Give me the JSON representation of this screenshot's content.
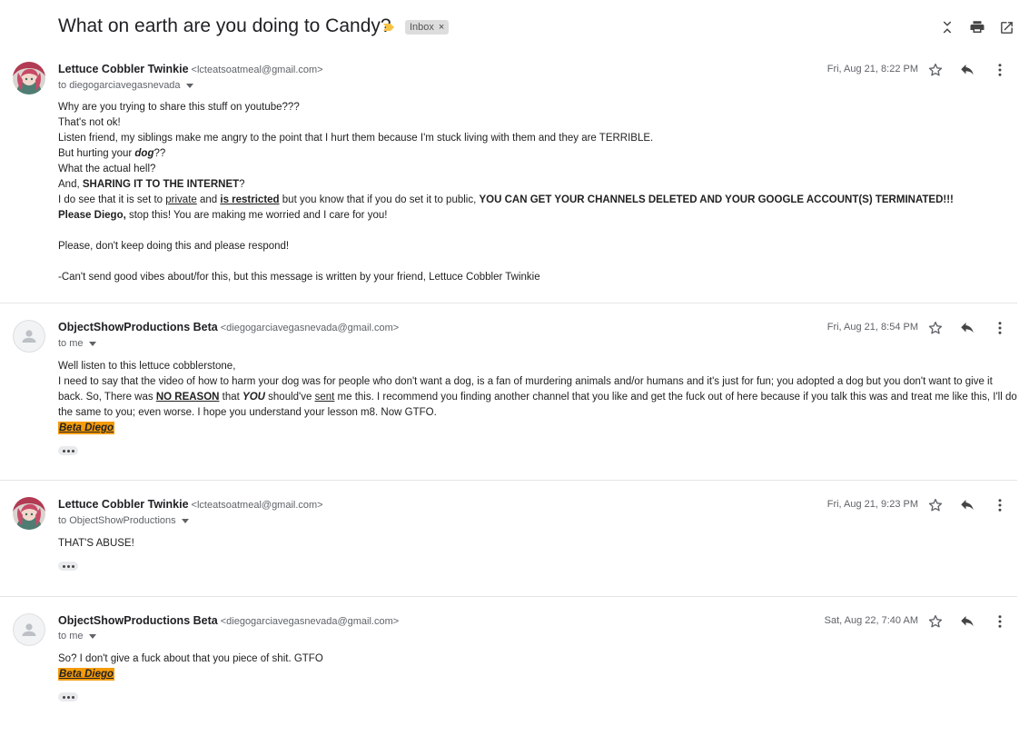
{
  "thread": {
    "subject": "What on earth are you doing to Candy?",
    "label": "Inbox",
    "label_remove": "×",
    "actions": [
      "collapse-all-icon",
      "print-icon",
      "open-in-new-window-icon"
    ]
  },
  "messages": [
    {
      "sender_name": "Lettuce Cobbler Twinkie",
      "sender_email": "<lcteatsoatmeal@gmail.com>",
      "to": "to diegogarciavegasnevada",
      "date": "Fri, Aug 21, 8:22 PM",
      "avatar": "anime-avatar",
      "body": {
        "l1": "Why are you trying to share this stuff on youtube???",
        "l2": "That's not ok!",
        "l3": "Listen friend, my siblings make me angry to the point that I hurt them because I'm stuck living with them and they are TERRIBLE.",
        "l4a": "But hurting your ",
        "l4b": "dog",
        "l4c": "??",
        "l5": "What the actual hell?",
        "l6a": "And, ",
        "l6b": "SHARING IT TO THE INTERNET",
        "l6c": "?",
        "l7a": "I do see that it is set to ",
        "l7b": "private",
        "l7c": " and ",
        "l7d": "is restricted",
        "l7e": " but you know that if you do set it to public, ",
        "l7f": "YOU CAN GET YOUR CHANNELS DELETED AND YOUR GOOGLE ACCOUNT(S) TERMINATED!!!",
        "l8a": "Please Diego,",
        "l8b": " stop this! You are making me worried and I care for you!",
        "l9": "Please, don't keep doing this and please respond!",
        "l10": "-Can't send good vibes about/for this, but this message is written by your friend, Lettuce Cobbler Twinkie"
      }
    },
    {
      "sender_name": "ObjectShowProductions Beta",
      "sender_email": "<diegogarciavegasnevada@gmail.com>",
      "to": "to me",
      "date": "Fri, Aug 21, 8:54 PM",
      "avatar": "default-person-avatar",
      "body": {
        "l1": "Well listen to this lettuce cobblerstone,",
        "l2a": "I need to say that the video of how to harm your dog was for people who don't want a dog, is a fan of murdering animals and/or humans and it's just for fun; you adopted a dog but you don't want to give it back. So, There was ",
        "l2b": "NO REASON",
        "l2c": " that ",
        "l2d": "YOU",
        "l2e": " should've ",
        "l2f": "sent",
        "l2g": " me this. I recommend you finding another channel that you like and get the fuck out of here because if you talk this was and treat me like this, I'll do the same to you; even worse. I hope you understand your lesson m8. Now GTFO.",
        "signature": "Beta Diego"
      }
    },
    {
      "sender_name": "Lettuce Cobbler Twinkie",
      "sender_email": "<lcteatsoatmeal@gmail.com>",
      "to": "to ObjectShowProductions",
      "date": "Fri, Aug 21, 9:23 PM",
      "avatar": "anime-avatar",
      "body": {
        "l1": "THAT'S ABUSE!"
      }
    },
    {
      "sender_name": "ObjectShowProductions Beta",
      "sender_email": "<diegogarciavegasnevada@gmail.com>",
      "to": "to me",
      "date": "Sat, Aug 22, 7:40 AM",
      "avatar": "default-person-avatar",
      "body": {
        "l1": "So? I don't give a fuck about that you piece of shit. GTFO",
        "signature": "Beta Diego"
      }
    }
  ],
  "colors": {
    "signature_bg": "#f59b0a",
    "important_marker": "#f6c343",
    "label_chip": "#dddddd"
  }
}
